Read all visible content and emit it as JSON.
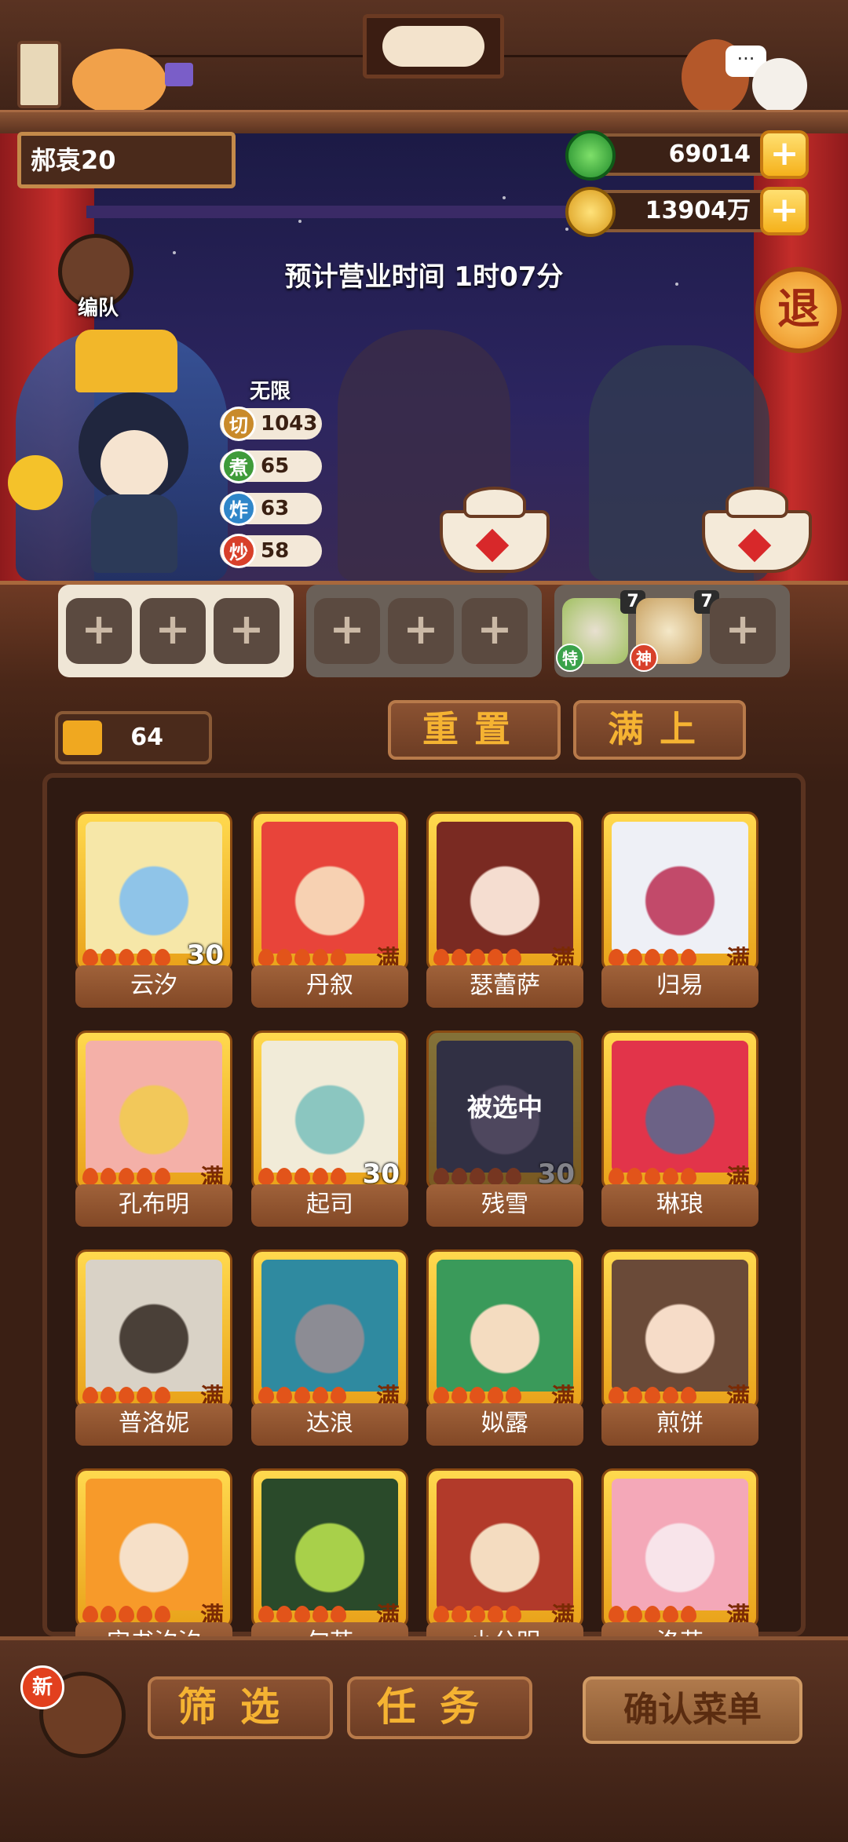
{
  "header": {
    "player_name": "郝袁20",
    "jade_amount": "69014",
    "gold_amount": "13904万",
    "plus_label": "+"
  },
  "stage": {
    "business_hours": "预计营业时间  1时07分",
    "retreat_label": "退",
    "formation_label": "编队",
    "skill_limit_label": "无限",
    "skills": [
      {
        "icon": "切",
        "value": "1043",
        "color": "#c98a2a"
      },
      {
        "icon": "煮",
        "value": "65",
        "color": "#3f9b3a"
      },
      {
        "icon": "炸",
        "value": "63",
        "color": "#2f86c9"
      },
      {
        "icon": "炒",
        "value": "58",
        "color": "#d8402a"
      }
    ]
  },
  "slots": {
    "plus_label": "+",
    "dishes": [
      {
        "count": "7",
        "tag": "特",
        "tag_color": "#3aa24a"
      },
      {
        "count": "7",
        "tag": "神",
        "tag_color": "#d8402a"
      }
    ]
  },
  "toolbar": {
    "tickets": "64",
    "reset_label": "重置",
    "fill_label": "满上"
  },
  "characters": [
    {
      "name": "云汐",
      "badge": "30",
      "badge_type": "level",
      "colors": [
        "#f6e7a8",
        "#8fc4e8"
      ]
    },
    {
      "name": "丹叙",
      "badge": "满",
      "badge_type": "full",
      "colors": [
        "#e8443a",
        "#f7d1b2"
      ]
    },
    {
      "name": "瑟蕾萨",
      "badge": "满",
      "badge_type": "full",
      "colors": [
        "#7a2a22",
        "#f5ddd0"
      ]
    },
    {
      "name": "归易",
      "badge": "满",
      "badge_type": "full",
      "colors": [
        "#eef0f6",
        "#c24a6a"
      ]
    },
    {
      "name": "孔布明",
      "badge": "满",
      "badge_type": "full",
      "colors": [
        "#f4b0a8",
        "#f2c85a"
      ]
    },
    {
      "name": "起司",
      "badge": "30",
      "badge_type": "level",
      "colors": [
        "#f1ebd8",
        "#8bc6c0"
      ]
    },
    {
      "name": "残雪",
      "badge": "30",
      "badge_type": "level",
      "colors": [
        "#4a4866",
        "#8b7aa0"
      ],
      "overlay": "被选中"
    },
    {
      "name": "琳琅",
      "badge": "满",
      "badge_type": "full",
      "colors": [
        "#e2344a",
        "#6c6286"
      ]
    },
    {
      "name": "普洛妮",
      "badge": "满",
      "badge_type": "full",
      "colors": [
        "#d9d2c6",
        "#4a4038"
      ]
    },
    {
      "name": "达浪",
      "badge": "满",
      "badge_type": "full",
      "colors": [
        "#2f8aa0",
        "#8c8c94"
      ]
    },
    {
      "name": "姒露",
      "badge": "满",
      "badge_type": "full",
      "colors": [
        "#3a9a5a",
        "#f4dcc0"
      ]
    },
    {
      "name": "煎饼",
      "badge": "满",
      "badge_type": "full",
      "colors": [
        "#6a4a38",
        "#f6dcc8"
      ]
    },
    {
      "name": "宋书汐汐",
      "badge": "满",
      "badge_type": "full",
      "colors": [
        "#f79a2a",
        "#f6e0c8"
      ]
    },
    {
      "name": "句芒",
      "badge": "满",
      "badge_type": "full",
      "colors": [
        "#2a4a2a",
        "#a8d04a"
      ]
    },
    {
      "name": "小公明",
      "badge": "满",
      "badge_type": "full",
      "colors": [
        "#b23a2a",
        "#f4dcc0"
      ]
    },
    {
      "name": "洛花",
      "badge": "满",
      "badge_type": "full",
      "colors": [
        "#f4a8b8",
        "#f8e4ea"
      ]
    }
  ],
  "bottom": {
    "new_badge": "新",
    "filter_label": "筛选",
    "task_label": "任务",
    "confirm_label": "确认菜单"
  }
}
